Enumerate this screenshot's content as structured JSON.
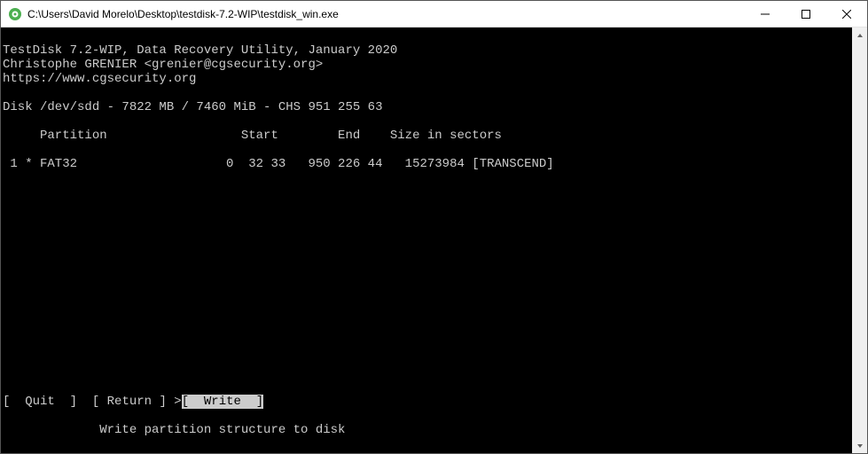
{
  "window": {
    "title": "C:\\Users\\David Morelo\\Desktop\\testdisk-7.2-WIP\\testdisk_win.exe"
  },
  "header": {
    "line1": "TestDisk 7.2-WIP, Data Recovery Utility, January 2020",
    "line2": "Christophe GRENIER <grenier@cgsecurity.org>",
    "line3": "https://www.cgsecurity.org"
  },
  "disk": {
    "line": "Disk /dev/sdd - 7822 MB / 7460 MiB - CHS 951 255 63"
  },
  "table": {
    "header": "     Partition                  Start        End    Size in sectors",
    "rows": [
      " 1 * FAT32                    0  32 33   950 226 44   15273984 [TRANSCEND]"
    ]
  },
  "menu": {
    "prefix": "[  ",
    "quit": "Quit",
    "sep1": "  ]  [ ",
    "return": "Return",
    "sep2": " ] ",
    "cursor": ">",
    "write_l": "[  ",
    "write": "Write",
    "write_r": "  ]"
  },
  "help": {
    "line": "             Write partition structure to disk"
  }
}
